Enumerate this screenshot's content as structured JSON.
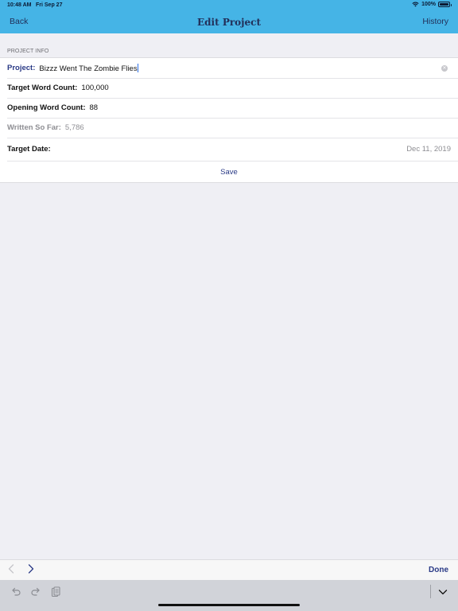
{
  "status": {
    "time": "10:48 AM",
    "date": "Fri Sep 27",
    "battery": "100%"
  },
  "nav": {
    "back_label": "Back",
    "title": "Edit Project",
    "history_label": "History"
  },
  "section": {
    "header": "PROJECT INFO"
  },
  "form": {
    "project_label": "Project:",
    "project_value": "Bizzz Went The Zombie Flies",
    "target_label": "Target Word Count:",
    "target_value": "100,000",
    "opening_label": "Opening Word Count:",
    "opening_value": "88",
    "written_label": "Written So Far:",
    "written_value": "5,786",
    "date_label": "Target Date:",
    "date_value": "Dec 11, 2019",
    "save_label": "Save"
  },
  "keyboard": {
    "done_label": "Done"
  },
  "colors": {
    "nav_bg": "#45b4e6",
    "accent": "#2a3a86",
    "page_bg": "#efeff4"
  },
  "icons": [
    "wifi-icon",
    "battery-icon",
    "clear-icon",
    "chevron-left-icon",
    "chevron-right-icon",
    "undo-icon",
    "redo-icon",
    "paste-icon",
    "chevron-down-icon"
  ]
}
